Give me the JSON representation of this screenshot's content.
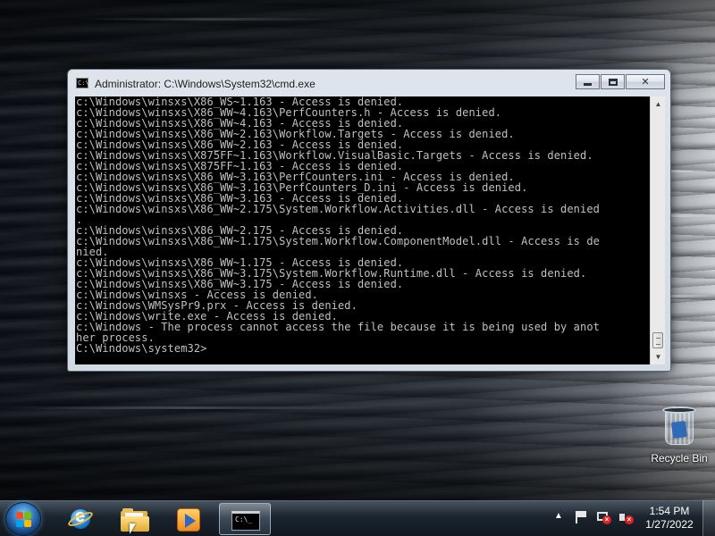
{
  "window": {
    "title": "Administrator: C:\\Windows\\System32\\cmd.exe",
    "icon_name": "cmd-icon"
  },
  "console": {
    "lines": [
      "c:\\Windows\\winsxs\\X86_WS~1.163 - Access is denied.",
      "c:\\Windows\\winsxs\\X86_WW~4.163\\PerfCounters.h - Access is denied.",
      "c:\\Windows\\winsxs\\X86_WW~4.163 - Access is denied.",
      "c:\\Windows\\winsxs\\X86_WW~2.163\\Workflow.Targets - Access is denied.",
      "c:\\Windows\\winsxs\\X86_WW~2.163 - Access is denied.",
      "c:\\Windows\\winsxs\\X875FF~1.163\\Workflow.VisualBasic.Targets - Access is denied.",
      "c:\\Windows\\winsxs\\X875FF~1.163 - Access is denied.",
      "c:\\Windows\\winsxs\\X86_WW~3.163\\PerfCounters.ini - Access is denied.",
      "c:\\Windows\\winsxs\\X86_WW~3.163\\PerfCounters_D.ini - Access is denied.",
      "c:\\Windows\\winsxs\\X86_WW~3.163 - Access is denied.",
      "c:\\Windows\\winsxs\\X86_WW~2.175\\System.Workflow.Activities.dll - Access is denied",
      ".",
      "c:\\Windows\\winsxs\\X86_WW~2.175 - Access is denied.",
      "c:\\Windows\\winsxs\\X86_WW~1.175\\System.Workflow.ComponentModel.dll - Access is de",
      "nied.",
      "c:\\Windows\\winsxs\\X86_WW~1.175 - Access is denied.",
      "c:\\Windows\\winsxs\\X86_WW~3.175\\System.Workflow.Runtime.dll - Access is denied.",
      "c:\\Windows\\winsxs\\X86_WW~3.175 - Access is denied.",
      "c:\\Windows\\winsxs - Access is denied.",
      "c:\\Windows\\WMSysPr9.prx - Access is denied.",
      "c:\\Windows\\write.exe - Access is denied.",
      "c:\\Windows - The process cannot access the file because it is being used by anot",
      "her process."
    ],
    "prompt": "C:\\Windows\\system32>"
  },
  "desktop": {
    "recycle_bin_label": "Recycle Bin"
  },
  "taskbar": {
    "pinned": [
      "internet-explorer-icon",
      "windows-explorer-icon",
      "media-player-icon",
      "cmd-icon"
    ],
    "active": "cmd-icon"
  },
  "tray": {
    "time": "1:54 PM",
    "date": "1/27/2022"
  }
}
